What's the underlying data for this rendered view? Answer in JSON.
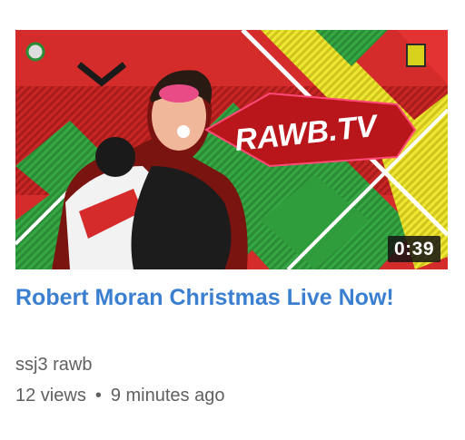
{
  "video": {
    "duration": "0:39",
    "thumbnail_brand_text": "RAWB.TV",
    "title": "Robert Moran Christmas Live Now!",
    "channel": "ssj3 rawb",
    "views": "12 views",
    "separator": "•",
    "uploaded": "9 minutes ago"
  },
  "colors": {
    "title": "#3b7fd1",
    "meta": "#606060",
    "thumb_red": "#d32a2a",
    "thumb_green": "#3fb24a",
    "thumb_yellow": "#e8e32a"
  }
}
